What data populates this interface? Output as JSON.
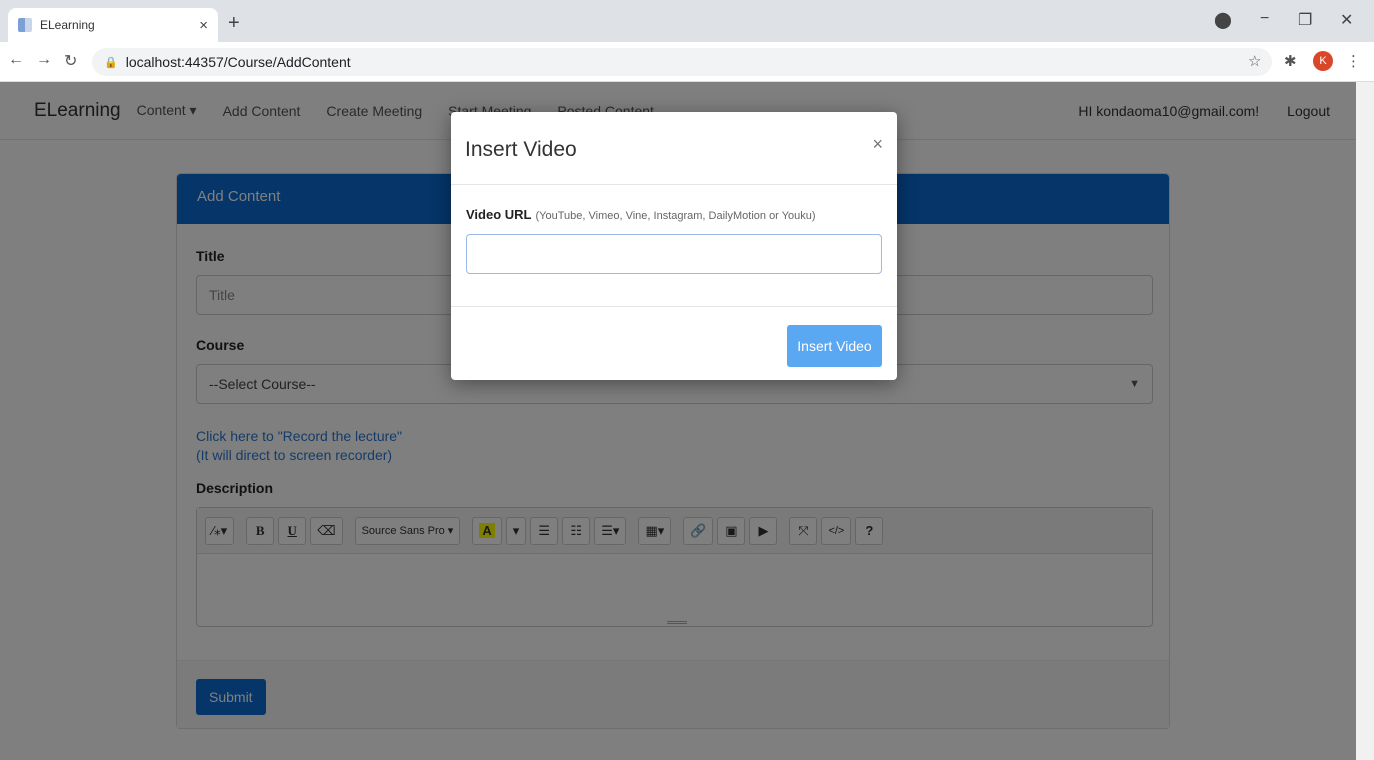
{
  "browser": {
    "tab_title": "ELearning",
    "tab_close": "×",
    "new_tab": "+",
    "url": "localhost:44357/Course/AddContent",
    "profile_initial": "K"
  },
  "navbar": {
    "brand": "ELearning",
    "links": [
      "Content ▾",
      "Add Content",
      "Create Meeting",
      "Start Meeting",
      "Posted Content"
    ],
    "greeting": "HI kondaoma10@gmail.com!",
    "logout": "Logout"
  },
  "form": {
    "header": "Add Content",
    "title_label": "Title",
    "title_placeholder": "Title",
    "course_label": "Course",
    "course_selected": "--Select Course--",
    "record_line1": "Click here to \"Record the lecture\"",
    "record_line2": "(It will direct to screen recorder)",
    "description_label": "Description",
    "toolbar": {
      "magic": "⁄⁎▾",
      "bold": "B",
      "underline": "U",
      "eraser": "⌫",
      "font": "Source Sans Pro ▾",
      "color": "A",
      "color_drop": "▾",
      "ul": "☰",
      "ol": "☷",
      "align": "☰▾",
      "table": "▦▾",
      "link": "🔗",
      "picture": "▣",
      "video": "▶",
      "fullscreen": "⤧",
      "code": "</>",
      "help": "?"
    },
    "submit": "Submit"
  },
  "modal": {
    "title": "Insert Video",
    "close": "×",
    "url_label": "Video URL",
    "url_hint": "(YouTube, Vimeo, Vine, Instagram, DailyMotion or Youku)",
    "url_value": "",
    "button": "Insert Video"
  }
}
